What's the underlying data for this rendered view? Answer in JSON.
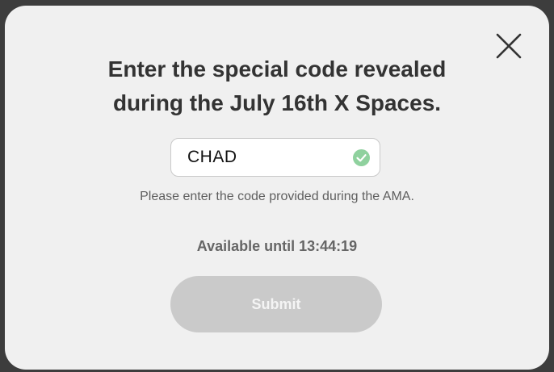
{
  "modal": {
    "title_line1": "Enter the special code revealed",
    "title_line2": "during the July 16th X Spaces.",
    "close_icon": "close-x-icon",
    "code_input": {
      "value": "CHAD",
      "status_icon": "check-circle-icon",
      "status_color": "#8fd19e"
    },
    "hint": "Please enter the code provided during the AMA.",
    "availability": "Available until 13:44:19",
    "submit_label": "Submit",
    "submit_color": "#cacaca"
  }
}
